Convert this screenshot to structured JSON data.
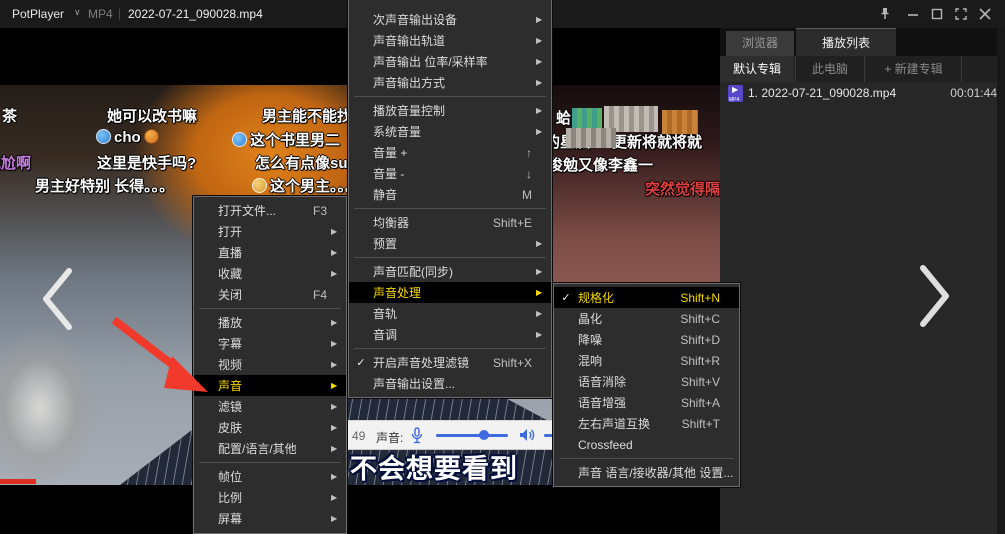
{
  "window": {
    "title_bar": {
      "app_name": "PotPlayer",
      "caret": "∨",
      "codec_badge": "MP4",
      "divider": "|",
      "filename": "2022-07-21_090028.mp4"
    }
  },
  "icons": {
    "submenu_arrow": "▶",
    "check": "✓",
    "play": "▶"
  },
  "playlist": {
    "tab_browser": "浏览器",
    "tab_playlist": "播放列表",
    "album_tabs": {
      "default": "默认专辑",
      "this_pc": "此电脑",
      "new_album": "+ 新建专辑"
    },
    "item": {
      "title": "1. 2022-07-21_090028.mp4",
      "duration": "00:01:44",
      "file_type": "MP4"
    }
  },
  "menus": {
    "main": {
      "items": [
        {
          "label": "打开文件...",
          "shortcut": "F3"
        },
        {
          "label": "打开"
        },
        {
          "label": "直播"
        },
        {
          "label": "收藏"
        },
        {
          "label": "关闭",
          "shortcut": "F4"
        },
        {
          "label": "播放"
        },
        {
          "label": "字幕"
        },
        {
          "label": "视频"
        },
        {
          "label": "声音"
        },
        {
          "label": "滤镜"
        },
        {
          "label": "皮肤"
        },
        {
          "label": "配置/语言/其他"
        },
        {
          "label": "帧位"
        },
        {
          "label": "比例"
        },
        {
          "label": "屏幕"
        }
      ]
    },
    "audio": {
      "items": [
        {
          "label": "次声音输出设备"
        },
        {
          "label": "声音输出轨道"
        },
        {
          "label": "声音输出 位率/采样率"
        },
        {
          "label": "声音输出方式"
        },
        {
          "label": "播放音量控制"
        },
        {
          "label": "系统音量"
        },
        {
          "label": "音量 +",
          "shortcut": "↑"
        },
        {
          "label": "音量 -",
          "shortcut": "↓"
        },
        {
          "label": "静音",
          "shortcut": "M"
        },
        {
          "label": "均衡器",
          "shortcut": "Shift+E"
        },
        {
          "label": "预置"
        },
        {
          "label": "声音匹配(同步)"
        },
        {
          "label": "声音处理"
        },
        {
          "label": "音轨"
        },
        {
          "label": "音调"
        },
        {
          "label": "开启声音处理滤镜",
          "shortcut": "Shift+X"
        },
        {
          "label": "声音输出设置..."
        }
      ]
    },
    "processing": {
      "items": [
        {
          "label": "规格化",
          "shortcut": "Shift+N"
        },
        {
          "label": "晶化",
          "shortcut": "Shift+C"
        },
        {
          "label": "降噪",
          "shortcut": "Shift+D"
        },
        {
          "label": "混响",
          "shortcut": "Shift+R"
        },
        {
          "label": "语音消除",
          "shortcut": "Shift+V"
        },
        {
          "label": "语音增强",
          "shortcut": "Shift+A"
        },
        {
          "label": "左右声道互换",
          "shortcut": "Shift+T"
        },
        {
          "label": "Crossfeed"
        },
        {
          "label": "声音 语言/接收器/其他 设置..."
        }
      ]
    }
  },
  "danmaku": {
    "left": [
      {
        "text": "茶"
      },
      {
        "text": "她可以改书嘛"
      },
      {
        "text": "男主能不能找"
      },
      {
        "text": "cho"
      },
      {
        "text": "这个书里男二"
      },
      {
        "text": "尴尬啊"
      },
      {
        "text": "这里是快手吗?"
      },
      {
        "text": "怎么有点像suho"
      },
      {
        "text": "男主好特别 长得。。。"
      },
      {
        "text": "这个男主。。。"
      }
    ],
    "right": [
      {
        "text": "蛤"
      },
      {
        "text": "的星汉"
      },
      {
        "text": "更新将就将就"
      },
      {
        "text": "俊勉又像李鑫一"
      },
      {
        "text": "突然觉得隔壁"
      }
    ],
    "subtitle": "不会想要看到"
  },
  "volume_osd": {
    "value": "49",
    "label": "声音:"
  }
}
